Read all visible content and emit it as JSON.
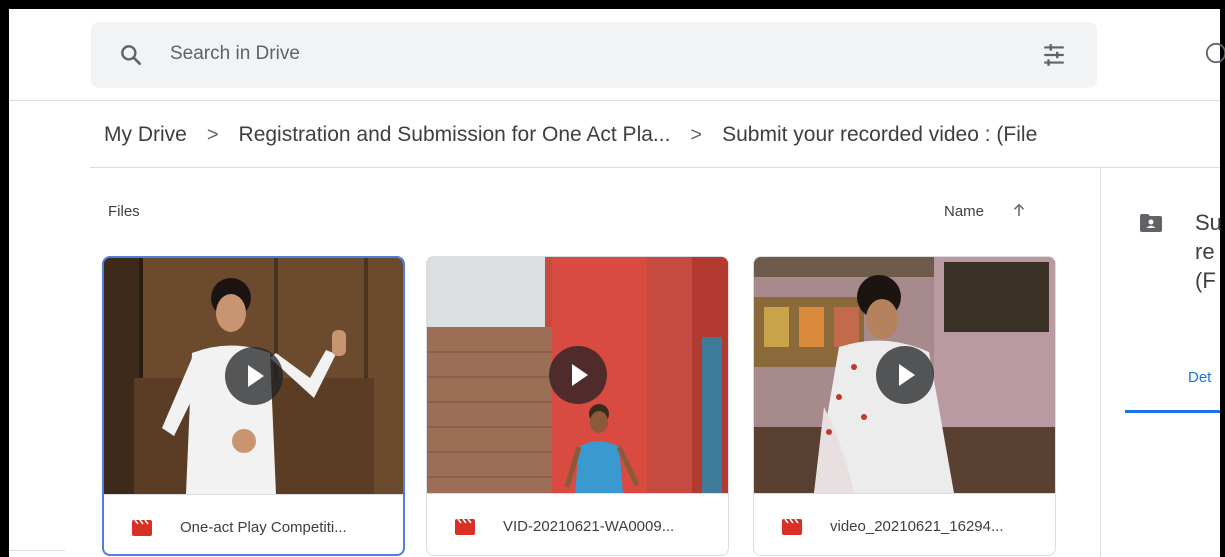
{
  "search": {
    "placeholder": "Search in Drive"
  },
  "breadcrumb": [
    "My Drive",
    "Registration and Submission for One Act Pla...",
    "Submit your recorded video : (File"
  ],
  "breadcrumb_separator": ">",
  "files_section": {
    "label": "Files",
    "sort_label": "Name",
    "sort_direction": "ascending"
  },
  "files": [
    {
      "name": "One-act Play Competiti...",
      "type": "video",
      "selected": true
    },
    {
      "name": "VID-20210621-WA0009...",
      "type": "video",
      "selected": false
    },
    {
      "name": "video_20210621_16294...",
      "type": "video",
      "selected": false
    }
  ],
  "details_panel": {
    "title_lines": [
      "Su",
      "re",
      "(F"
    ],
    "tab_label": "Det"
  },
  "colors": {
    "accent": "#1a73e8",
    "video_icon": "#d93025",
    "search_bg": "#f1f3f4",
    "selected_border": "#4f7fd9"
  },
  "icons": [
    "search-icon",
    "tune-icon",
    "help-icon",
    "sort-arrow-up-icon",
    "video-file-icon",
    "shared-folder-icon",
    "play-icon"
  ]
}
